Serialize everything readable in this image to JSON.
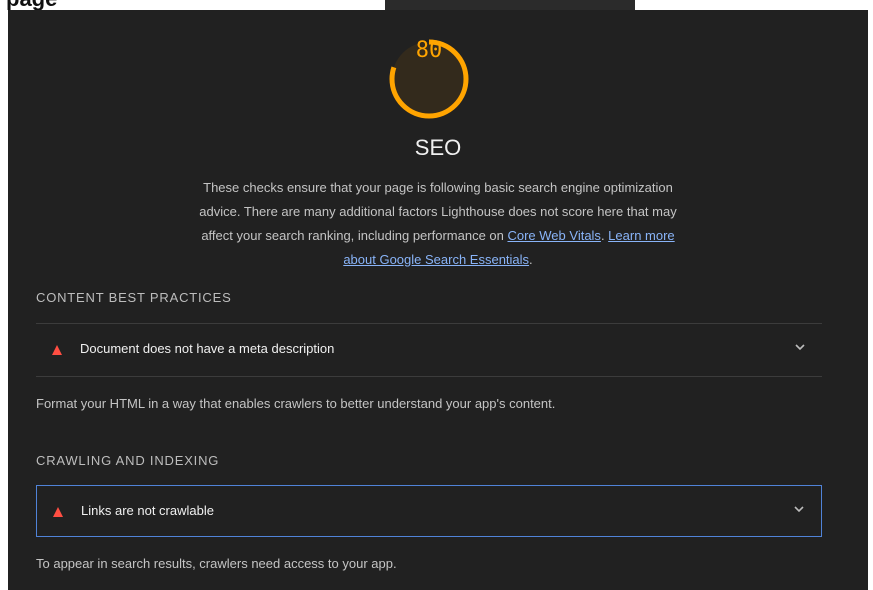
{
  "page": {
    "partial_heading": "page"
  },
  "category": {
    "score": "80",
    "score_fraction": 0.8,
    "title": "SEO",
    "description": "These checks ensure that your page is following basic search engine optimization advice. There are many additional factors Lighthouse does not score here that may affect your search ranking, including performance on ",
    "link_core_web_vitals": "Core Web Vitals",
    "separator": ". ",
    "link_learn_more": "Learn more about Google Search Essentials",
    "end_punct": "."
  },
  "groups": [
    {
      "header": "CONTENT BEST PRACTICES",
      "audit_title": "Document does not have a meta description",
      "description": "Format your HTML in a way that enables crawlers to better understand your app's content."
    },
    {
      "header": "CRAWLING AND INDEXING",
      "audit_title": "Links are not crawlable",
      "description": "To appear in search results, crawlers need access to your app."
    }
  ],
  "icons": {
    "fail": "fail-triangle-icon",
    "expand": "chevron-down-icon"
  },
  "colors": {
    "panel_bg": "#212121",
    "score_average": "#ffa400",
    "fail": "#ff4e42",
    "link": "#89b4f8",
    "focus_border": "#5083d8"
  }
}
